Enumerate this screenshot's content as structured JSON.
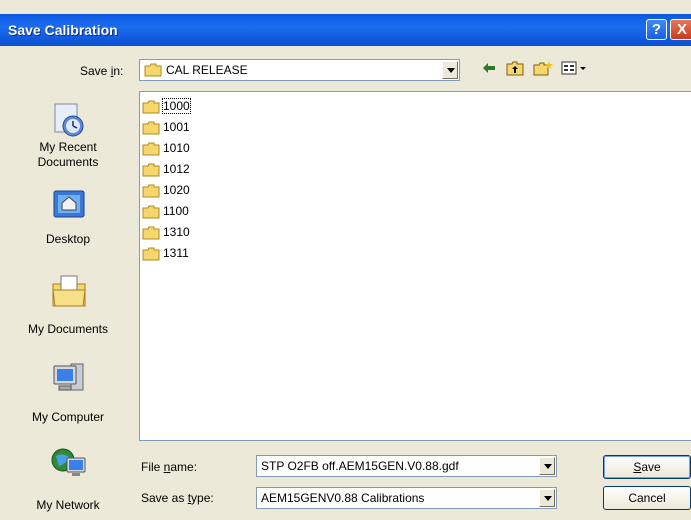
{
  "window": {
    "title": "Save Calibration"
  },
  "titlebar_buttons": {
    "help": "?",
    "close": "X"
  },
  "save_in": {
    "label_pre": "Save ",
    "label_key": "i",
    "label_post": "n:",
    "value": "CAL RELEASE"
  },
  "toolbar": {
    "icons": [
      "back-icon",
      "up-folder-icon",
      "new-folder-icon",
      "view-menu-icon"
    ]
  },
  "places": [
    {
      "label_line1": "My Recent",
      "label_line2": "Documents",
      "icon": "recent-documents-icon"
    },
    {
      "label_line1": "Desktop",
      "label_line2": "",
      "icon": "desktop-icon"
    },
    {
      "label_line1": "My Documents",
      "label_line2": "",
      "icon": "my-documents-icon"
    },
    {
      "label_line1": "My Computer",
      "label_line2": "",
      "icon": "my-computer-icon"
    },
    {
      "label_line1": "My Network",
      "label_line2": "",
      "icon": "my-network-icon"
    }
  ],
  "files": [
    {
      "name": "1000",
      "selected": true
    },
    {
      "name": "1001",
      "selected": false
    },
    {
      "name": "1010",
      "selected": false
    },
    {
      "name": "1012",
      "selected": false
    },
    {
      "name": "1020",
      "selected": false
    },
    {
      "name": "1100",
      "selected": false
    },
    {
      "name": "1310",
      "selected": false
    },
    {
      "name": "1311",
      "selected": false
    }
  ],
  "file_name": {
    "label_pre": "File ",
    "label_key": "n",
    "label_post": "ame:",
    "value": "STP O2FB off.AEM15GEN.V0.88.gdf"
  },
  "save_as_type": {
    "label_pre": "Save as ",
    "label_key": "t",
    "label_post": "ype:",
    "value": "AEM15GENV0.88 Calibrations"
  },
  "buttons": {
    "save_key": "S",
    "save_rest": "ave",
    "cancel": "Cancel"
  },
  "colors": {
    "titlebar": "#0a58e0",
    "dialog_bg": "#ece9d8",
    "folder": "#f5d76e"
  }
}
